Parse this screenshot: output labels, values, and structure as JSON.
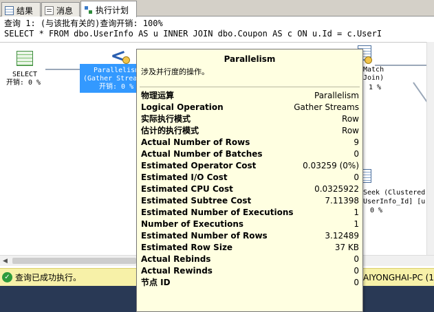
{
  "tabs": [
    {
      "label": "结果",
      "icon": "grid-icon"
    },
    {
      "label": "消息",
      "icon": "message-icon"
    },
    {
      "label": "执行计划",
      "icon": "execution-plan-icon",
      "active": true
    }
  ],
  "query": {
    "line1": "查询 1: (与该批有关的)查询开销: 100%",
    "line2": "SELECT * FROM dbo.UserInfo AS u INNER JOIN dbo.Coupon AS c ON u.Id = c.UserI"
  },
  "plan": {
    "select_node": {
      "name": "SELECT",
      "cost": "开销: 0 %"
    },
    "parallelism_node": {
      "line1": "Parallelism",
      "line2": "(Gather Streams)",
      "cost": "开销: 0 %"
    },
    "right_node": {
      "line1": "Match",
      "line2": "Join)",
      "cost": "1 %"
    },
    "seek_node": {
      "line1": "Seek (Clustered)",
      "line2": "UserInfo_Id] [u]",
      "cost": "0 %"
    }
  },
  "tooltip": {
    "title": "Parallelism",
    "description": "涉及并行度的操作。",
    "rows": [
      {
        "label": "物理运算",
        "value": "Parallelism"
      },
      {
        "label": "Logical Operation",
        "value": "Gather Streams"
      },
      {
        "label": "实际执行模式",
        "value": "Row"
      },
      {
        "label": "估计的执行模式",
        "value": "Row"
      },
      {
        "label": "Actual Number of Rows",
        "value": "9"
      },
      {
        "label": "Actual Number of Batches",
        "value": "0"
      },
      {
        "label": "Estimated Operator Cost",
        "value": "0.03259 (0%)"
      },
      {
        "label": "Estimated I/O Cost",
        "value": "0"
      },
      {
        "label": "Estimated CPU Cost",
        "value": "0.0325922"
      },
      {
        "label": "Estimated Subtree Cost",
        "value": "7.11398"
      },
      {
        "label": "Estimated Number of Executions",
        "value": "1"
      },
      {
        "label": "Number of Executions",
        "value": "1"
      },
      {
        "label": "Estimated Number of Rows",
        "value": "3.12489"
      },
      {
        "label": "Estimated Row Size",
        "value": "37 KB"
      },
      {
        "label": "Actual Rebinds",
        "value": "0"
      },
      {
        "label": "Actual Rewinds",
        "value": "0"
      },
      {
        "label": "节点 ID",
        "value": "0"
      }
    ]
  },
  "status": {
    "message": "查询已成功执行。",
    "server": "AIYONGHAI-PC (1"
  }
}
